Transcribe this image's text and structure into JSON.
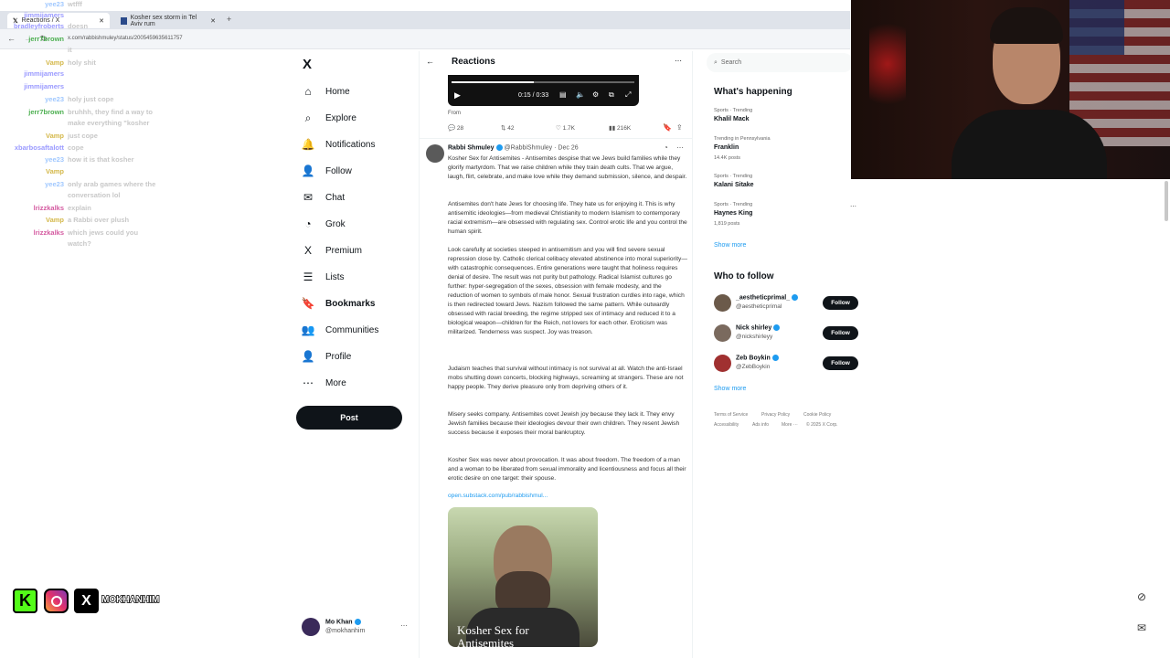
{
  "browser": {
    "tab1": "Reactions / X",
    "tab2": "Kosher sex storm in Tel Aviv rum",
    "url": "x.com/rabbishmuley/status/2005459635611757"
  },
  "chat": [
    {
      "user": "yee23",
      "msg": "wtfff",
      "color": "#a0c8ff"
    },
    {
      "user": "jimmijamers",
      "msg": "",
      "color": "#9a9aff"
    },
    {
      "user": "bradleyfroberts",
      "msg": "doesn",
      "color": "#9a9aff"
    },
    {
      "user": "jerr7brown",
      "msg": "",
      "color": "#4caf50"
    },
    {
      "user": "",
      "msg": "it",
      "color": "#fff"
    },
    {
      "user": "Vamp",
      "msg": "holy shit",
      "color": "#d4b84a"
    },
    {
      "user": "jimmijamers",
      "msg": "",
      "color": "#9a9aff"
    },
    {
      "user": "jimmijamers",
      "msg": "",
      "color": "#9a9aff"
    },
    {
      "user": "yee23",
      "msg": "holy just cope",
      "color": "#a0c8ff"
    },
    {
      "user": "jerr7brown",
      "msg": "bruhhh, they find a way to",
      "color": "#4caf50"
    },
    {
      "user": "",
      "msg": "make everything \"kosher",
      "color": "#fff"
    },
    {
      "user": "Vamp",
      "msg": "just cope",
      "color": "#d4b84a"
    },
    {
      "user": "xbarbosaftalott",
      "msg": "cope",
      "color": "#9a9aff"
    },
    {
      "user": "yee23",
      "msg": "how it is that kosher",
      "color": "#a0c8ff"
    },
    {
      "user": "Vamp",
      "msg": "",
      "color": "#d4b84a"
    },
    {
      "user": "yee23",
      "msg": "only arab games where the",
      "color": "#a0c8ff"
    },
    {
      "user": "",
      "msg": "conversation lol",
      "color": "#fff"
    },
    {
      "user": "lrizzkalks",
      "msg": "explain",
      "color": "#d45aa0"
    },
    {
      "user": "Vamp",
      "msg": "a Rabbi over plush",
      "color": "#d4b84a"
    },
    {
      "user": "lrizzkalks",
      "msg": "which jews could you",
      "color": "#d45aa0"
    },
    {
      "user": "",
      "msg": "watch?",
      "color": "#fff"
    }
  ],
  "nav": {
    "logo": "X",
    "items": [
      {
        "label": "Home",
        "icon": "⌂"
      },
      {
        "label": "Explore",
        "icon": "⌕"
      },
      {
        "label": "Notifications",
        "icon": "🔔"
      },
      {
        "label": "Follow",
        "icon": "👤"
      },
      {
        "label": "Chat",
        "icon": "✉"
      },
      {
        "label": "Grok",
        "icon": "◔"
      },
      {
        "label": "Premium",
        "icon": "X"
      },
      {
        "label": "Lists",
        "icon": "☰"
      },
      {
        "label": "Bookmarks",
        "icon": "🔖"
      },
      {
        "label": "Communities",
        "icon": "👥"
      },
      {
        "label": "Profile",
        "icon": "👤"
      },
      {
        "label": "More",
        "icon": "⋯"
      }
    ],
    "post": "Post",
    "account_name": "Mo Khan",
    "account_handle": "@mokhanhim"
  },
  "header": {
    "title": "Reactions"
  },
  "video": {
    "time": "0:15 / 0:33"
  },
  "prev_tweet": {
    "from": "From",
    "replies": "28",
    "reposts": "42",
    "likes": "1.7K",
    "views": "216K"
  },
  "tweet": {
    "author": "Rabbi Shmuley",
    "handle": "@RabbiShmuley",
    "date": "Dec 26",
    "paragraphs": [
      "Kosher Sex for Antisemites - Antisemites despise that we Jews build families while they glorify martyrdom. That we raise children while they train death cults. That we argue, laugh, flirt, celebrate, and make love while they demand submission, silence, and despair.",
      "Antisemites don't hate Jews for choosing life. They hate us for enjoying it. This is why antisemitic ideologies—from medieval Christianity to modern Islamism to contemporary racial extremism—are obsessed with regulating sex. Control erotic life and you control the human spirit.",
      "Look carefully at societies steeped in antisemitism and you will find severe sexual repression close by. Catholic clerical celibacy elevated abstinence into moral superiority—with catastrophic consequences. Entire generations were taught that holiness requires denial of desire. The result was not purity but pathology. Radical Islamist cultures go further: hyper-segregation of the sexes, obsession with female modesty, and the reduction of women to symbols of male honor. Sexual frustration curdles into rage, which is then redirected toward Jews. Nazism followed the same pattern. While outwardly obsessed with racial breeding, the regime stripped sex of intimacy and reduced it to a biological weapon—children for the Reich, not lovers for each other. Eroticism was militarized. Tenderness was suspect. Joy was treason.",
      "Judaism teaches that survival without intimacy is not survival at all. Watch the anti-Israel mobs shutting down concerts, blocking highways, screaming at strangers. These are not happy people. They derive pleasure only from depriving others of it.",
      "Misery seeks company. Antisemites covet Jewish joy because they lack it. They envy Jewish families because their ideologies devour their own children. They resent Jewish success because it exposes their moral bankruptcy.",
      "Kosher Sex was never about provocation. It was about freedom. The freedom of a man and a woman to be liberated from sexual immorality and licentiousness and focus all their erotic desire on one target: their spouse."
    ],
    "link": "open.substack.com/pub/rabbishmul...",
    "card_title": "Kosher Sex for Antisemites"
  },
  "search": {
    "placeholder": "Search"
  },
  "trending": {
    "title": "What's happening",
    "items": [
      {
        "cat": "Sports · Trending",
        "name": "Khalil Mack",
        "count": ""
      },
      {
        "cat": "Trending in Pennsylvania",
        "name": "Franklin",
        "count": "14.4K posts"
      },
      {
        "cat": "Sports · Trending",
        "name": "Kalani Sitake",
        "count": ""
      },
      {
        "cat": "Sports · Trending",
        "name": "Haynes King",
        "count": "1,819 posts"
      }
    ],
    "show_more": "Show more"
  },
  "who_to_follow": {
    "title": "Who to follow",
    "items": [
      {
        "name": "_aestheticprimal_",
        "handle": "@aestheticprimal",
        "color": "#6b5a4a"
      },
      {
        "name": "Nick shirley",
        "handle": "@nickshirleyy",
        "color": "#7a6a5e"
      },
      {
        "name": "Zeb Boykin",
        "handle": "@ZebBoykin",
        "color": "#a03030"
      }
    ],
    "follow": "Follow",
    "show_more": "Show more"
  },
  "footer": [
    "Terms of Service",
    "Privacy Policy",
    "Cookie Policy",
    "Accessibility",
    "Ads info",
    "More ···",
    "© 2025 X Corp."
  ],
  "socials": {
    "handle": "MOKHANHIM"
  }
}
